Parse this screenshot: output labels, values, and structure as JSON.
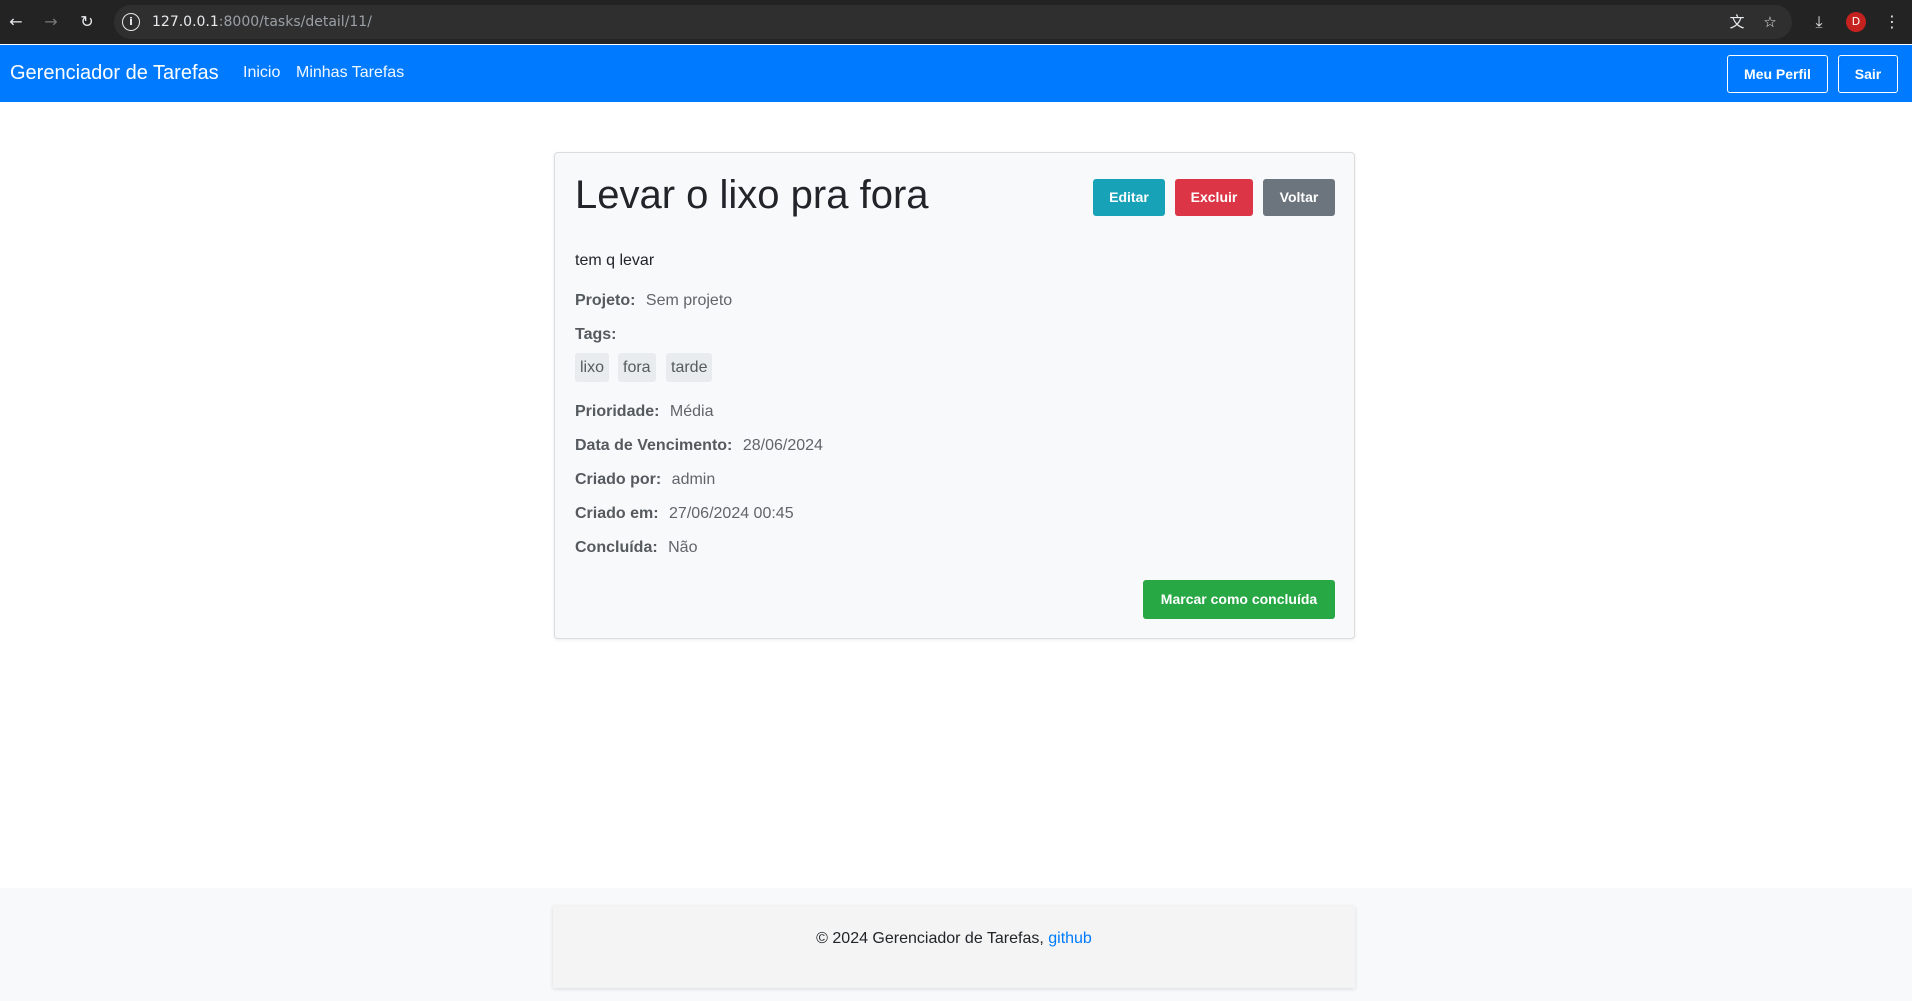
{
  "browser": {
    "url_host": "127.0.0.1",
    "url_rest": ":8000/tasks/detail/11/",
    "profile_initial": "D",
    "icons": {
      "back": "←",
      "forward": "→",
      "reload": "↻",
      "info": "i",
      "translate": "文",
      "bookmark": "☆",
      "download": "⤓",
      "menu": "⋮"
    }
  },
  "navbar": {
    "brand": "Gerenciador de Tarefas",
    "links": [
      "Inicio",
      "Minhas Tarefas"
    ],
    "profile_button": "Meu Perfil",
    "logout_button": "Sair",
    "color": "#007bff"
  },
  "task": {
    "title": "Levar o lixo pra fora",
    "actions": {
      "edit": "Editar",
      "delete": "Excluir",
      "back": "Voltar"
    },
    "description": "tem q levar",
    "project": {
      "label": "Projeto:",
      "value": "Sem projeto"
    },
    "tags_label": "Tags:",
    "tags": [
      "lixo",
      "fora",
      "tarde"
    ],
    "priority": {
      "label": "Prioridade:",
      "value": "Média"
    },
    "due_date": {
      "label": "Data de Vencimento:",
      "value": "28/06/2024"
    },
    "created_by": {
      "label": "Criado por:",
      "value": "admin"
    },
    "created_at": {
      "label": "Criado em:",
      "value": "27/06/2024 00:45"
    },
    "completed": {
      "label": "Concluída:",
      "value": "Não"
    },
    "complete_button": "Marcar como concluída"
  },
  "footer": {
    "text": "© 2024 Gerenciador de Tarefas, ",
    "link": "github"
  },
  "colors": {
    "info": "#17a2b8",
    "danger": "#dc3545",
    "secondary": "#6c757d",
    "success": "#28a745",
    "link": "#007bff"
  }
}
